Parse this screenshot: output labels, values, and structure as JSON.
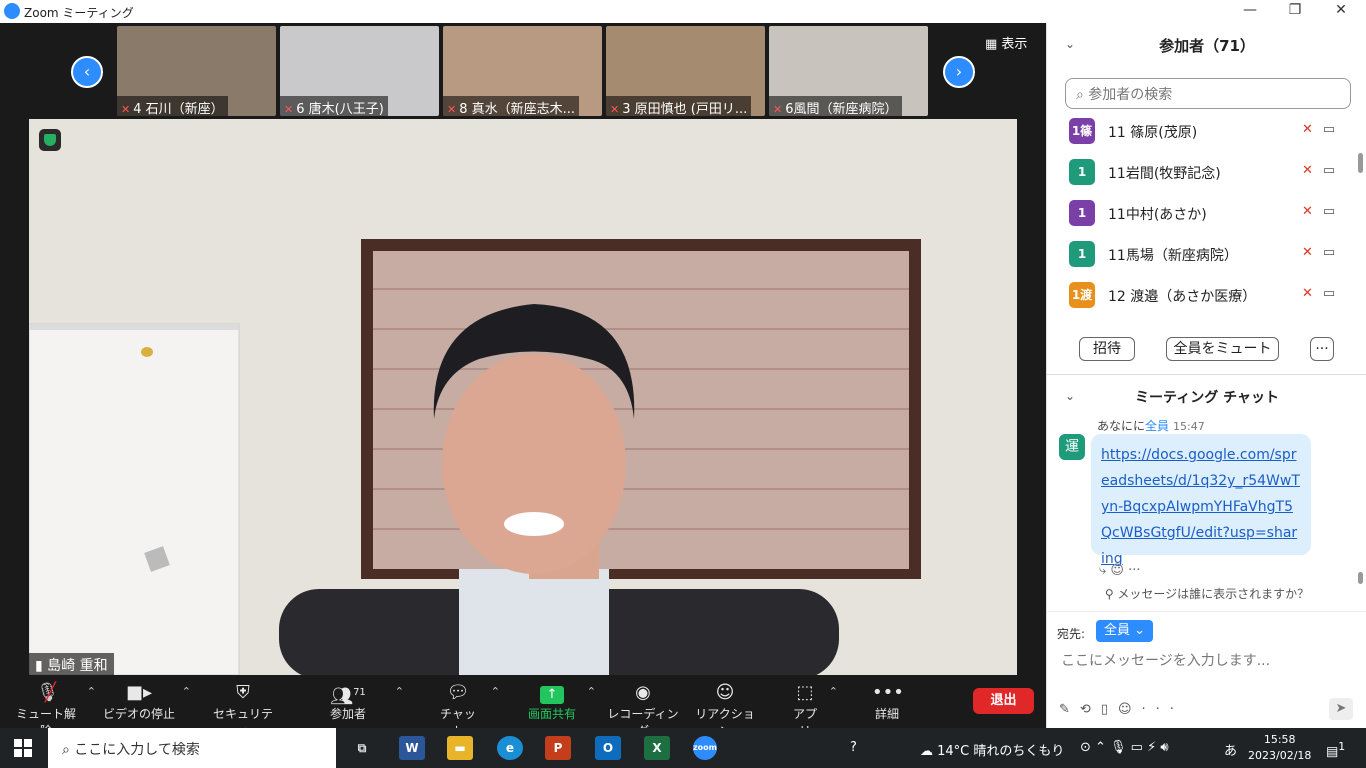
{
  "window": {
    "title": "Zoom ミーティング",
    "minimize": "—",
    "maximize": "❐",
    "close": "✕"
  },
  "gallery": {
    "view_label": "表示",
    "prev": "‹",
    "next": "›",
    "thumbnails": [
      {
        "name": "4 石川（新座）",
        "bg": "#8a7a6a"
      },
      {
        "name": "6 唐木(八王子)",
        "bg": "#c9c9cc"
      },
      {
        "name": "8 真水（新座志木...",
        "bg": "#b89a82"
      },
      {
        "name": "3 原田慎也 (戸田リ...",
        "bg": "#a58b70"
      },
      {
        "name": "6風間（新座病院）",
        "bg": "#c8c4bd"
      }
    ]
  },
  "speaker": {
    "name": "島崎 重和"
  },
  "toolbar": {
    "mute": "ミュート解除",
    "video": "ビデオの停止",
    "security": "セキュリティ",
    "participants": "参加者",
    "participants_count": "71",
    "chat": "チャット",
    "share": "画面共有",
    "record": "レコーディング",
    "reactions": "リアクション",
    "apps": "アプリ",
    "more": "詳細",
    "leave": "退出"
  },
  "participants_panel": {
    "title": "参加者（71）",
    "search_placeholder": "参加者の検索",
    "rows": [
      {
        "avatar": "1篠",
        "name": "11 篠原(茂原)",
        "color": "#7b3fa8"
      },
      {
        "avatar": "1",
        "name": "11岩間(牧野記念)",
        "color": "#1f9a7a"
      },
      {
        "avatar": "1",
        "name": "11中村(あさか)",
        "color": "#7b3fa8"
      },
      {
        "avatar": "1",
        "name": "11馬場（新座病院）",
        "color": "#1f9a7a"
      },
      {
        "avatar": "1渡",
        "name": "12 渡邉（あさか医療）",
        "color": "#e8901c"
      }
    ],
    "invite": "招待",
    "mute_all": "全員をミュート",
    "more": "···"
  },
  "chat": {
    "title": "ミーティング チャット",
    "sender": "あなにに",
    "to": "全員",
    "time": "15:47",
    "avatar": "運",
    "message": "https://docs.google.com/spreadsheets/d/1q32y_r54WwTyn-BqcxpAIwpmYHFaVhgT5QcWBsGtgfU/edit?usp=sharing",
    "who_sees": "メッセージは誰に表示されますか？",
    "to_label": "宛先:",
    "to_value": "全員",
    "input_placeholder": "ここにメッセージを入力します..."
  },
  "taskbar": {
    "search_placeholder": "ここに入力して検索",
    "weather": "14°C  晴れのちくもり",
    "ime": "あ",
    "time": "15:58",
    "date": "2023/02/18",
    "notification_count": "1"
  }
}
